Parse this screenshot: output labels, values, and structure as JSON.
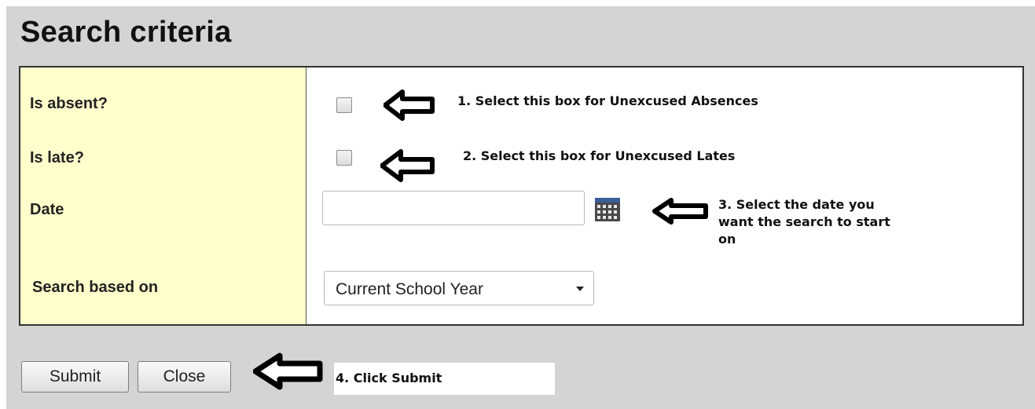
{
  "page": {
    "title": "Search criteria"
  },
  "fields": {
    "absent_label": "Is absent?",
    "late_label": "Is late?",
    "date_label": "Date",
    "date_value": "",
    "search_based_on_label": "Search based on",
    "search_based_on_value": "Current School Year"
  },
  "annotations": {
    "step1": "1.  Select this box for Unexcused Absences",
    "step2": "2.  Select this box for Unexcused Lates",
    "step3_line1": "3. Select the date you",
    "step3_line2": "want the search to start",
    "step3_line3": "on",
    "step4": "4. Click Submit"
  },
  "buttons": {
    "submit": "Submit",
    "close": "Close"
  },
  "icons": {
    "calendar": "calendar-icon",
    "arrow": "left-arrow-icon"
  },
  "colors": {
    "label_column": "#ffffcc",
    "panel": "#d4d4d4"
  }
}
